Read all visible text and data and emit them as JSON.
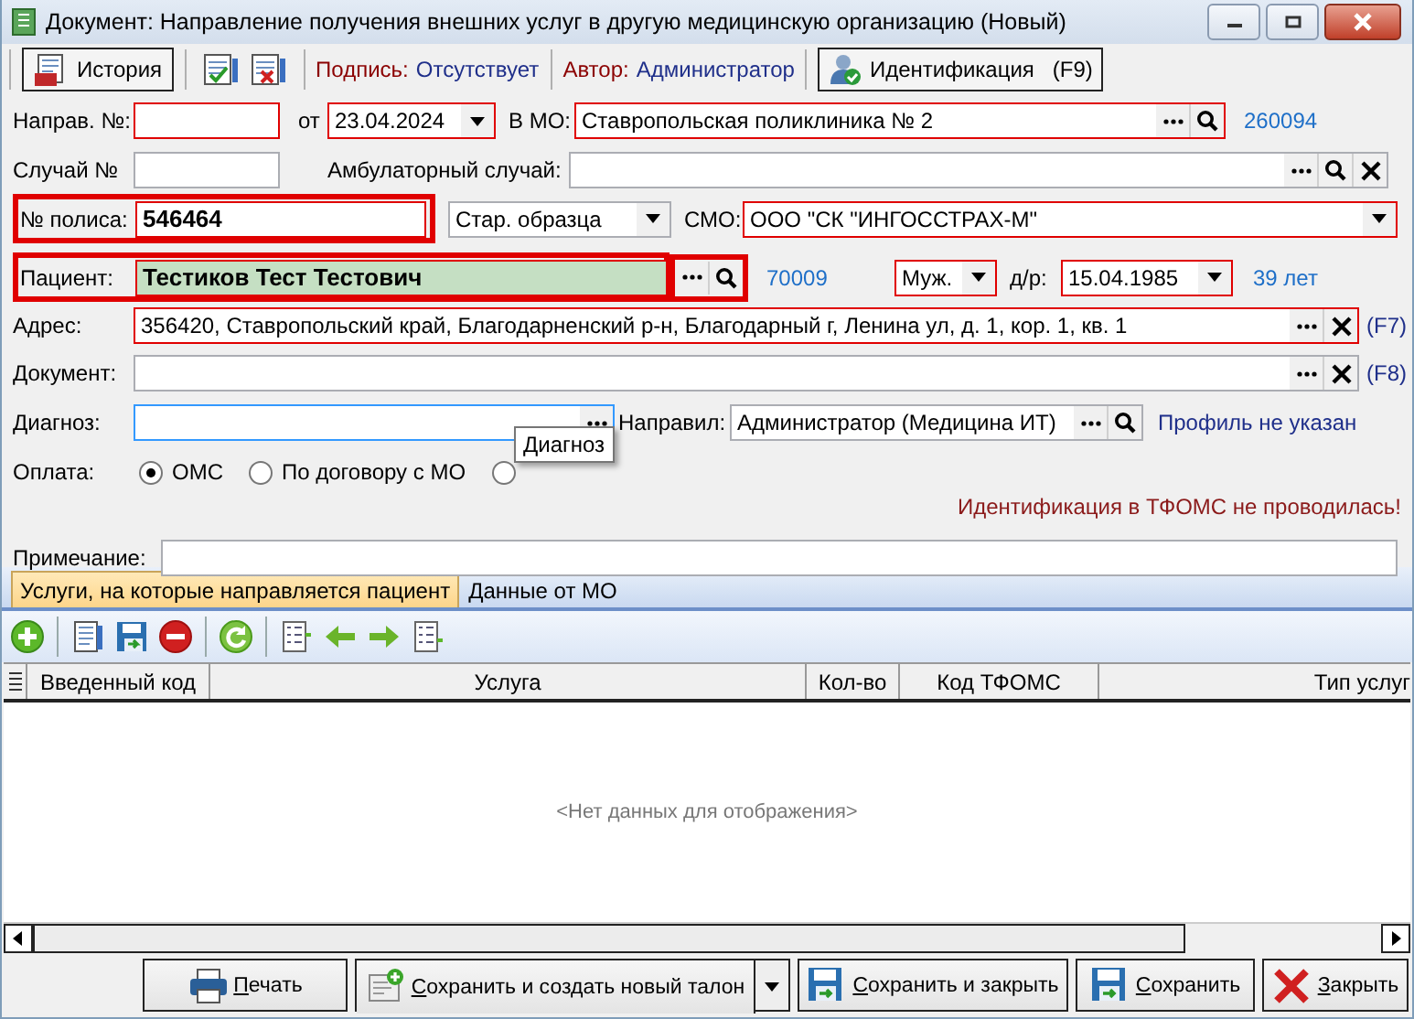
{
  "window": {
    "title": "Документ: Направление получения внешних услуг в другую медицинскую организацию (Новый)"
  },
  "toolbar": {
    "history_button": "История",
    "signature": {
      "label": "Подпись:",
      "value": "Отсутствует"
    },
    "author": {
      "label": "Автор:",
      "value": "Администратор"
    },
    "identify_button": {
      "label": "Идентификация",
      "shortcut": "(F9)"
    }
  },
  "form": {
    "referral_no": {
      "label": "Направ. №:",
      "error": true
    },
    "date": {
      "label": "от",
      "value": "23.04.2024",
      "error": true
    },
    "mo": {
      "label": "В МО:",
      "value": "Ставропольская поликлиника № 2",
      "error": true,
      "code": "260094"
    },
    "case_no": {
      "label": "Случай №",
      "error": false
    },
    "outpatient_case": {
      "label": "Амбулаторный случай:",
      "error": false
    },
    "policy": {
      "label": "№ полиса:",
      "value": "546464",
      "error": true,
      "highlighted": true
    },
    "policy_type": {
      "value": "Стар. образца",
      "error": false
    },
    "smo": {
      "label": "СМО:",
      "value": "ООО \"СК \"ИНГОССТРАХ-М\"",
      "error": true
    },
    "patient": {
      "label": "Пациент:",
      "value": "Тестиков Тест Тестович",
      "error": true,
      "highlighted": true,
      "matched": true,
      "buttons_highlighted": true
    },
    "patient_id": "70009",
    "sex": {
      "value": "Муж.",
      "error": true
    },
    "birth_date": {
      "label": "д/р:",
      "value": "15.04.1985",
      "error": true
    },
    "age": "39 лет",
    "address": {
      "label": "Адрес:",
      "value": "356420, Ставропольский край, Благодарненский р-н, Благодарный г, Ленина ул, д. 1, кор. 1, кв. 1",
      "error": true,
      "shortcut": "(F7)"
    },
    "document": {
      "label": "Документ:",
      "error": false,
      "shortcut": "(F8)"
    },
    "diagnosis": {
      "label": "Диагноз:",
      "focused": true,
      "tooltip": "Диагноз"
    },
    "referred_by": {
      "label": "Направил:",
      "value": "Администратор (Медицина ИТ)",
      "profile_link": "Профиль не указан"
    },
    "payment": {
      "label": "Оплата:",
      "options": [
        {
          "label": "ОМС",
          "selected": true
        },
        {
          "label": "По договору с МО",
          "selected": false
        },
        {
          "selected": false
        }
      ]
    },
    "identification_warning": "Идентификация в ТФОМС не проводилась!",
    "note": {
      "label": "Примечание:"
    }
  },
  "tabs": [
    {
      "label": "Услуги, на которые направляется пациент",
      "selected": true
    },
    {
      "label": "Данные от МО",
      "selected": false
    }
  ],
  "grid": {
    "columns": [
      "Введенный код",
      "Услуга",
      "Кол-во",
      "Код ТФОМС",
      "Тип услуг"
    ],
    "empty_text": "<Нет данных для отображения>"
  },
  "footer": {
    "buttons": [
      {
        "kind": "print",
        "label": "Печать"
      },
      {
        "kind": "save-new",
        "label": "Сохранить и создать новый талон"
      },
      {
        "kind": "save-close",
        "label": "Сохранить и закрыть"
      },
      {
        "kind": "save",
        "label": "Сохранить"
      },
      {
        "kind": "close",
        "label": "Закрыть"
      }
    ]
  }
}
